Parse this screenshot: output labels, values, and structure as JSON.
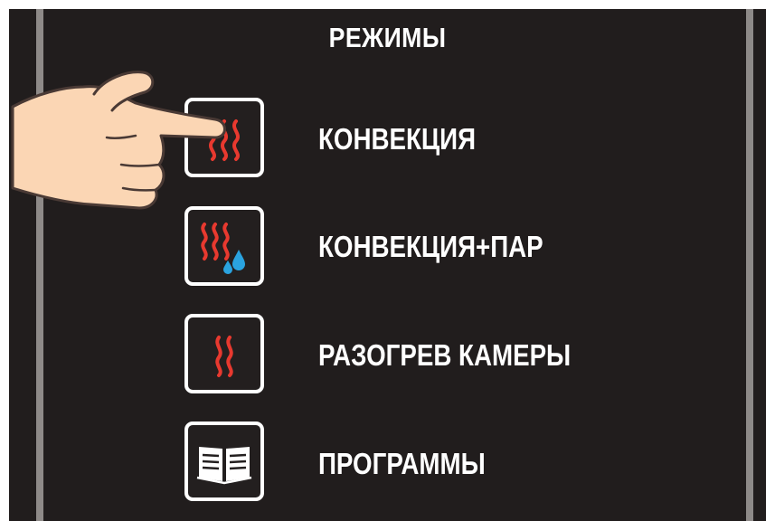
{
  "screen": {
    "title": "РЕЖИМЫ"
  },
  "modes": [
    {
      "label": "КОНВЕКЦИЯ",
      "icon": "convection-heat-waves-icon"
    },
    {
      "label": "КОНВЕКЦИЯ+ПАР",
      "icon": "convection-steam-icon"
    },
    {
      "label": "РАЗОГРЕВ КАМЕРЫ",
      "icon": "chamber-preheat-icon"
    },
    {
      "label": "ПРОГРАММЫ",
      "icon": "programs-book-icon"
    }
  ],
  "colors": {
    "panel_bg": "#211d1d",
    "heat_waves": "#e8392f",
    "water_drops": "#2aa3df",
    "text": "#ffffff"
  }
}
